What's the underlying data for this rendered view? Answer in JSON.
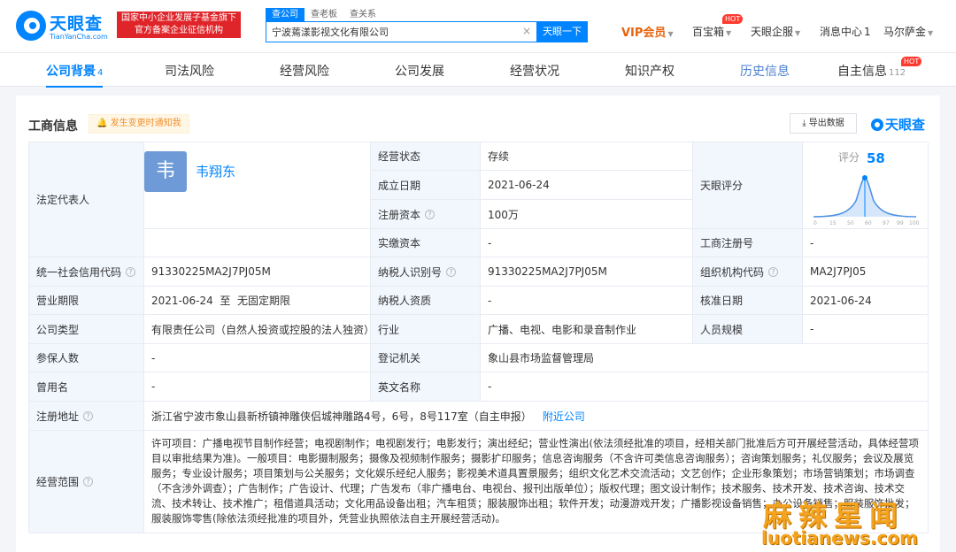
{
  "header": {
    "logo_text": "天眼查",
    "logo_sub": "TianYanCha.com",
    "gov_banner_line1": "国家中小企业发展子基金旗下",
    "gov_banner_line2": "官方备案企业征信机构",
    "search_tabs": [
      "查公司",
      "查老板",
      "查关系"
    ],
    "search_value": "宁波蔫漾影视文化有限公司",
    "search_button": "天眼一下",
    "nav": {
      "vip": "VIP会员",
      "treasure": "百宝箱",
      "hot": "HOT",
      "enterprise": "天眼企服",
      "messages": "消息中心",
      "message_count": "1",
      "user": "马尔萨金"
    }
  },
  "company_tabs": [
    {
      "label": "公司背景",
      "count": "4"
    },
    {
      "label": "司法风险",
      "count": ""
    },
    {
      "label": "经营风险",
      "count": ""
    },
    {
      "label": "公司发展",
      "count": ""
    },
    {
      "label": "经营状况",
      "count": ""
    },
    {
      "label": "知识产权",
      "count": ""
    },
    {
      "label": "历史信息",
      "count": ""
    },
    {
      "label": "自主信息",
      "count": "112"
    }
  ],
  "tab_hot": "HOT",
  "panel": {
    "title": "工商信息",
    "notify": "发生变更时通知我",
    "export": "导出数据",
    "brand": "天眼查"
  },
  "info": {
    "legal_rep_label": "法定代表人",
    "avatar_char": "韦",
    "legal_rep_name": "韦翔东",
    "status_label": "经营状态",
    "status_value": "存续",
    "founded_label": "成立日期",
    "founded_value": "2021-06-24",
    "reg_capital_label": "注册资本",
    "reg_capital_value": "100万",
    "score_label": "天眼评分",
    "score_title": "评分",
    "score_value": "58",
    "score_ticks": [
      "0",
      "15",
      "50",
      "60",
      "97",
      "99",
      "100"
    ],
    "paid_capital_label": "实缴资本",
    "paid_capital_value": "-",
    "biz_reg_no_label": "工商注册号",
    "biz_reg_no_value": "-",
    "credit_code_label": "统一社会信用代码",
    "credit_code_value": "91330225MA2J7PJ05M",
    "taxpayer_id_label": "纳税人识别号",
    "taxpayer_id_value": "91330225MA2J7PJ05M",
    "org_code_label": "组织机构代码",
    "org_code_value": "MA2J7PJ05",
    "term_label": "营业期限",
    "term_value": "2021-06-24  至  无固定期限",
    "taxpayer_qual_label": "纳税人资质",
    "taxpayer_qual_value": "-",
    "approve_date_label": "核准日期",
    "approve_date_value": "2021-06-24",
    "company_type_label": "公司类型",
    "company_type_value": "有限责任公司（自然人投资或控股的法人独资）",
    "industry_label": "行业",
    "industry_value": "广播、电视、电影和录音制作业",
    "staff_size_label": "人员规模",
    "staff_size_value": "-",
    "insured_label": "参保人数",
    "insured_value": "-",
    "authority_label": "登记机关",
    "authority_value": "象山县市场监督管理局",
    "former_name_label": "曾用名",
    "former_name_value": "-",
    "english_name_label": "英文名称",
    "english_name_value": "-",
    "address_label": "注册地址",
    "address_value": "浙江省宁波市象山县新桥镇神雕侠侣城神雕路4号，6号，8号117室（自主申报）",
    "address_link": "附近公司",
    "scope_label": "经营范围",
    "scope_value": "许可项目：广播电视节目制作经营；电视剧制作；电视剧发行；电影发行；演出经纪；营业性演出(依法须经批准的项目，经相关部门批准后方可开展经营活动，具体经营项目以审批结果为准)。一般项目：电影摄制服务；摄像及视频制作服务；摄影扩印服务；信息咨询服务（不含许可类信息咨询服务）；咨询策划服务；礼仪服务；会议及展览服务；专业设计服务；项目策划与公关服务；文化娱乐经纪人服务；影视美术道具置景服务；组织文化艺术交流活动；文艺创作；企业形象策划；市场营销策划；市场调查（不含涉外调查）；广告制作；广告设计、代理；广告发布（非广播电台、电视台、报刊出版单位）；版权代理；图文设计制作；技术服务、技术开发、技术咨询、技术交流、技术转让、技术推广；租借道具活动；文化用品设备出租；汽车租赁；服装服饰出租；软件开发；动漫游戏开发；广播影视设备销售；办公设备销售；服装服饰批发；服装服饰零售(除依法须经批准的项目外，凭营业执照依法自主开展经营活动)。"
  },
  "watermark": {
    "title": "麻辣星闻",
    "url": "luotianews.com"
  },
  "colors": {
    "brand_blue": "#0084ff",
    "label_bg": "#f2f7fe",
    "gov_red": "#e0252a",
    "vip_orange": "#e8640c"
  }
}
